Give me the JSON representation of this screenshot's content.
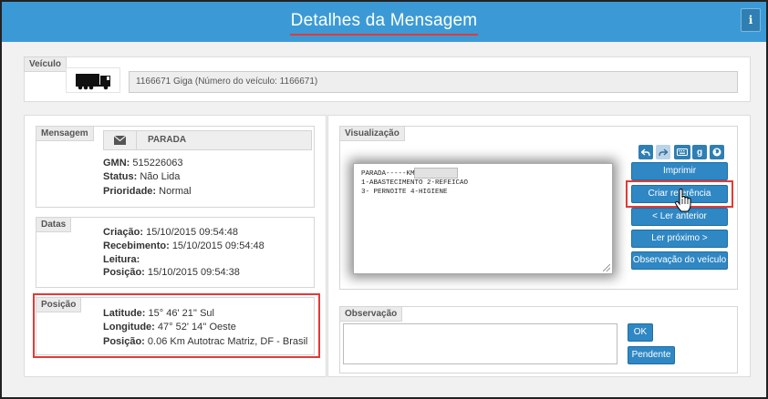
{
  "header": {
    "title": "Detalhes da Mensagem",
    "info_label": "i"
  },
  "veiculo": {
    "legend": "Veículo",
    "field_value": "1166671 Giga (Número do veículo: 1166671)",
    "icon": "truck-icon"
  },
  "mensagem": {
    "legend": "Mensagem",
    "type": "PARADA",
    "icon": "envelope-icon",
    "rows": [
      {
        "label": "GMN:",
        "value": "515226063"
      },
      {
        "label": "Status:",
        "value": "Não Lida"
      },
      {
        "label": "Prioridade:",
        "value": "Normal"
      }
    ]
  },
  "datas": {
    "legend": "Datas",
    "rows": [
      {
        "label": "Criação:",
        "value": "15/10/2015 09:54:48"
      },
      {
        "label": "Recebimento:",
        "value": "15/10/2015 09:54:48"
      },
      {
        "label": "Leitura:",
        "value": ""
      },
      {
        "label": "Posição:",
        "value": "15/10/2015 09:54:38"
      }
    ]
  },
  "posicao": {
    "legend": "Posição",
    "rows": [
      {
        "label": "Latitude:",
        "value": "15° 46' 21'' Sul"
      },
      {
        "label": "Longitude:",
        "value": "47° 52' 14'' Oeste"
      },
      {
        "label": "Posição:",
        "value": "0.06 Km Autotrac Matriz, DF - Brasil"
      }
    ]
  },
  "visualizacao": {
    "legend": "Visualização",
    "lines": [
      "PARADA-----KM",
      "1-ABASTECIMENTO 2-REFEICAO",
      "3- PERNOITE 4-HIGIENE"
    ],
    "toolbar_icons": [
      "reply-icon",
      "forward-icon",
      "keyboard-icon",
      "google-icon",
      "globe-icon"
    ],
    "buttons": {
      "imprimir": "Imprimir",
      "criar_referencia": "Criar referência",
      "ler_anterior": "< Ler anterior",
      "ler_proximo": "Ler próximo >",
      "observacao_veiculo": "Observação do veículo"
    }
  },
  "observacao": {
    "legend": "Observação",
    "value": "",
    "ok_label": "OK",
    "pendente_label": "Pendente"
  },
  "colors": {
    "header": "#3b9ad6",
    "button": "#2f87c4",
    "highlight": "#e53935"
  }
}
